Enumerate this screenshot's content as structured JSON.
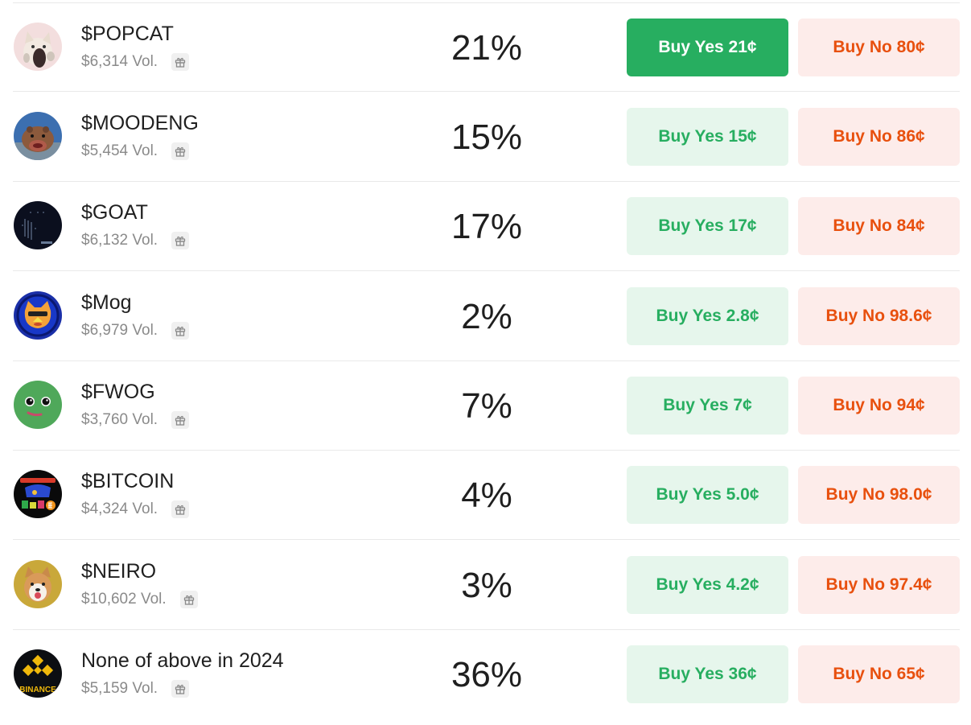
{
  "markets": [
    {
      "name": "$POPCAT",
      "volume": "$6,314 Vol.",
      "percent": "21%",
      "yes_label": "Buy Yes 21¢",
      "no_label": "Buy No 80¢",
      "yes_selected": true,
      "avatar_icon": "popcat-avatar-icon"
    },
    {
      "name": "$MOODENG",
      "volume": "$5,454 Vol.",
      "percent": "15%",
      "yes_label": "Buy Yes 15¢",
      "no_label": "Buy No 86¢",
      "yes_selected": false,
      "avatar_icon": "moodeng-avatar-icon"
    },
    {
      "name": "$GOAT",
      "volume": "$6,132 Vol.",
      "percent": "17%",
      "yes_label": "Buy Yes 17¢",
      "no_label": "Buy No 84¢",
      "yes_selected": false,
      "avatar_icon": "goat-avatar-icon"
    },
    {
      "name": "$Mog",
      "volume": "$6,979 Vol.",
      "percent": "2%",
      "yes_label": "Buy Yes 2.8¢",
      "no_label": "Buy No 98.6¢",
      "yes_selected": false,
      "avatar_icon": "mog-avatar-icon"
    },
    {
      "name": "$FWOG",
      "volume": "$3,760 Vol.",
      "percent": "7%",
      "yes_label": "Buy Yes 7¢",
      "no_label": "Buy No 94¢",
      "yes_selected": false,
      "avatar_icon": "fwog-avatar-icon"
    },
    {
      "name": "$BITCOIN",
      "volume": "$4,324 Vol.",
      "percent": "4%",
      "yes_label": "Buy Yes 5.0¢",
      "no_label": "Buy No 98.0¢",
      "yes_selected": false,
      "avatar_icon": "bitcoin-meme-avatar-icon"
    },
    {
      "name": "$NEIRO",
      "volume": "$10,602 Vol.",
      "percent": "3%",
      "yes_label": "Buy Yes 4.2¢",
      "no_label": "Buy No 97.4¢",
      "yes_selected": false,
      "avatar_icon": "neiro-avatar-icon"
    },
    {
      "name": "None of above in 2024",
      "volume": "$5,159 Vol.",
      "percent": "36%",
      "yes_label": "Buy Yes 36¢",
      "no_label": "Buy No 65¢",
      "yes_selected": false,
      "avatar_icon": "binance-avatar-icon",
      "avatar_text": "BINANCE"
    }
  ],
  "colors": {
    "yes_text": "#27ae60",
    "yes_bg": "#e6f6ec",
    "yes_active_bg": "#27ae60",
    "no_text": "#e8500e",
    "no_bg": "#fdecea"
  },
  "icons": {
    "reward": "gift-icon"
  }
}
